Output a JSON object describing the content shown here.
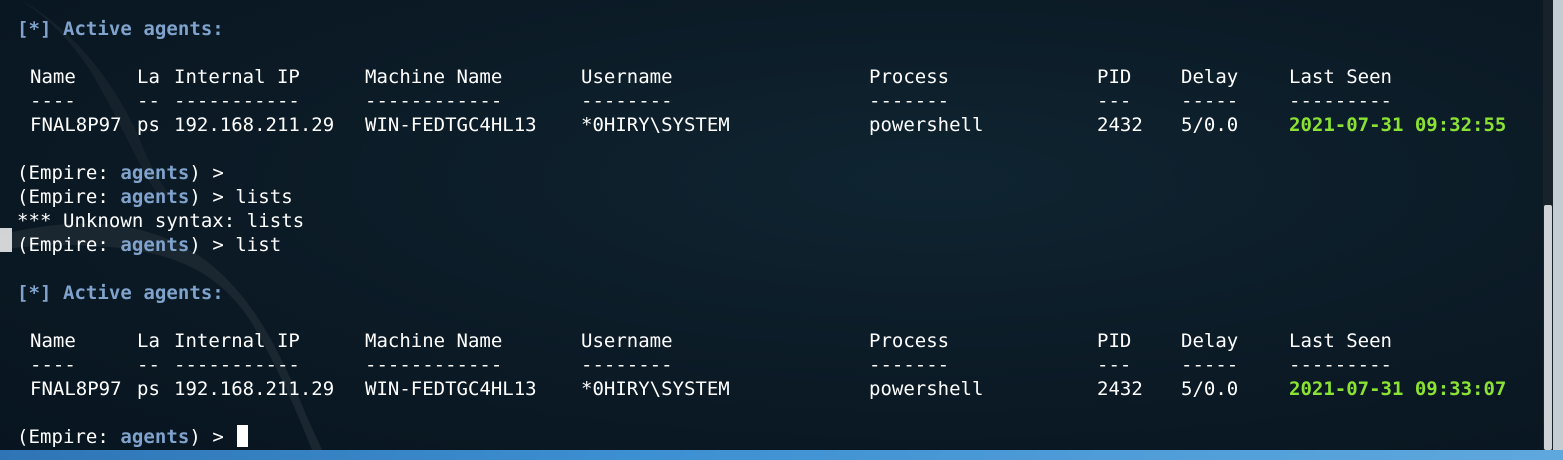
{
  "theme": {
    "background": "#0b1a25",
    "prompt_blue": "#7fa3cc",
    "timestamp_green": "#8ae234",
    "text": "#ffffff"
  },
  "block1": {
    "header": "[*] Active agents:",
    "columns": [
      "Name",
      "La",
      "Internal IP",
      "Machine Name",
      "Username",
      "Process",
      "PID",
      "Delay",
      "Last Seen"
    ],
    "separators": [
      "----",
      "--",
      "-----------",
      "------------",
      "--------",
      "-------",
      "---",
      "-----",
      "---------"
    ],
    "row": [
      "FNAL8P97",
      "ps",
      "192.168.211.29",
      "WIN-FEDTGC4HL13",
      "*0HIRY\\SYSTEM",
      "powershell",
      "2432",
      "5/0.0",
      "2021-07-31 09:32:55"
    ]
  },
  "history": [
    {
      "prefix": "(Empire: ",
      "context": "agents",
      "suffix": ") > ",
      "command": ""
    },
    {
      "prefix": "(Empire: ",
      "context": "agents",
      "suffix": ") > ",
      "command": "lists"
    },
    {
      "output": "*** Unknown syntax: lists"
    },
    {
      "prefix": "(Empire: ",
      "context": "agents",
      "suffix": ") > ",
      "command": "list"
    }
  ],
  "block2": {
    "header": "[*] Active agents:",
    "columns": [
      "Name",
      "La",
      "Internal IP",
      "Machine Name",
      "Username",
      "Process",
      "PID",
      "Delay",
      "Last Seen"
    ],
    "separators": [
      "----",
      "--",
      "-----------",
      "------------",
      "--------",
      "-------",
      "---",
      "-----",
      "---------"
    ],
    "row": [
      "FNAL8P97",
      "ps",
      "192.168.211.29",
      "WIN-FEDTGC4HL13",
      "*0HIRY\\SYSTEM",
      "powershell",
      "2432",
      "5/0.0",
      "2021-07-31 09:33:07"
    ]
  },
  "current_prompt": {
    "prefix": "(Empire: ",
    "context": "agents",
    "suffix": ") > ",
    "input": ""
  }
}
